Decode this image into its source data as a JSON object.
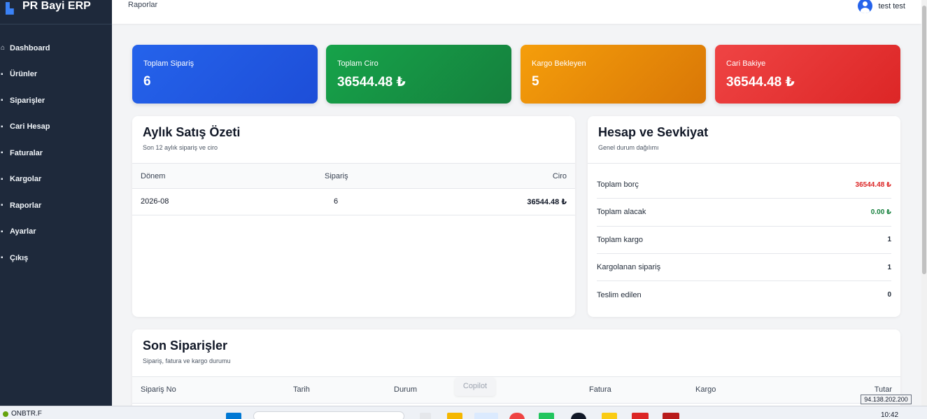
{
  "sidebar": {
    "brand": "PR Bayi ERP",
    "items": [
      {
        "label": "Dashboard",
        "icon": "home-icon"
      },
      {
        "label": "Ürünler",
        "icon": "box-icon"
      },
      {
        "label": "Siparişler",
        "icon": "cart-icon"
      },
      {
        "label": "Cari Hesap",
        "icon": "wallet-icon"
      },
      {
        "label": "Faturalar",
        "icon": "invoice-icon"
      },
      {
        "label": "Kargolar",
        "icon": "truck-icon"
      },
      {
        "label": "Raporlar",
        "icon": "chart-icon"
      },
      {
        "label": "Ayarlar",
        "icon": "gear-icon"
      },
      {
        "label": "Çıkış",
        "icon": "logout-icon"
      }
    ]
  },
  "header": {
    "breadcrumb": "Raporlar",
    "user_name": "test test"
  },
  "stats": [
    {
      "label": "Toplam Sipariş",
      "value": "6",
      "color": "#2563eb"
    },
    {
      "label": "Toplam Ciro",
      "value": "36544.48 ₺",
      "color": "#16a34a"
    },
    {
      "label": "Kargo Bekleyen",
      "value": "5",
      "color": "#f59e0b"
    },
    {
      "label": "Cari Bakiye",
      "value": "36544.48 ₺",
      "color": "#ef4444"
    }
  ],
  "sales_summary": {
    "title": "Aylık Satış Özeti",
    "subtitle": "Son 12 aylık sipariş ve ciro",
    "columns": {
      "period": "Dönem",
      "orders": "Sipariş",
      "revenue": "Ciro"
    },
    "rows": [
      {
        "period": "2026-08",
        "orders": "6",
        "revenue": "36544.48 ₺"
      }
    ]
  },
  "account": {
    "title": "Hesap ve Sevkiyat",
    "subtitle": "Genel durum dağılımı",
    "rows": [
      {
        "label": "Toplam borç",
        "value": "36544.48 ₺",
        "tone": "red"
      },
      {
        "label": "Toplam alacak",
        "value": "0.00 ₺",
        "tone": "green"
      },
      {
        "label": "Toplam kargo",
        "value": "1",
        "tone": "plain"
      },
      {
        "label": "Kargolanan sipariş",
        "value": "1",
        "tone": "plain"
      },
      {
        "label": "Teslim edilen",
        "value": "0",
        "tone": "plain"
      }
    ]
  },
  "recent_orders": {
    "title": "Son Siparişler",
    "subtitle": "Sipariş, fatura ve kargo durumu",
    "columns": [
      "Sipariş No",
      "Tarih",
      "Durum",
      "Fatura",
      "Kargo",
      "Tutar"
    ]
  },
  "overlay": {
    "copilot": "Copilot",
    "ip": "94.138.202.200"
  },
  "taskbar": {
    "weather": "ONBTR.F",
    "time": "10:42"
  }
}
